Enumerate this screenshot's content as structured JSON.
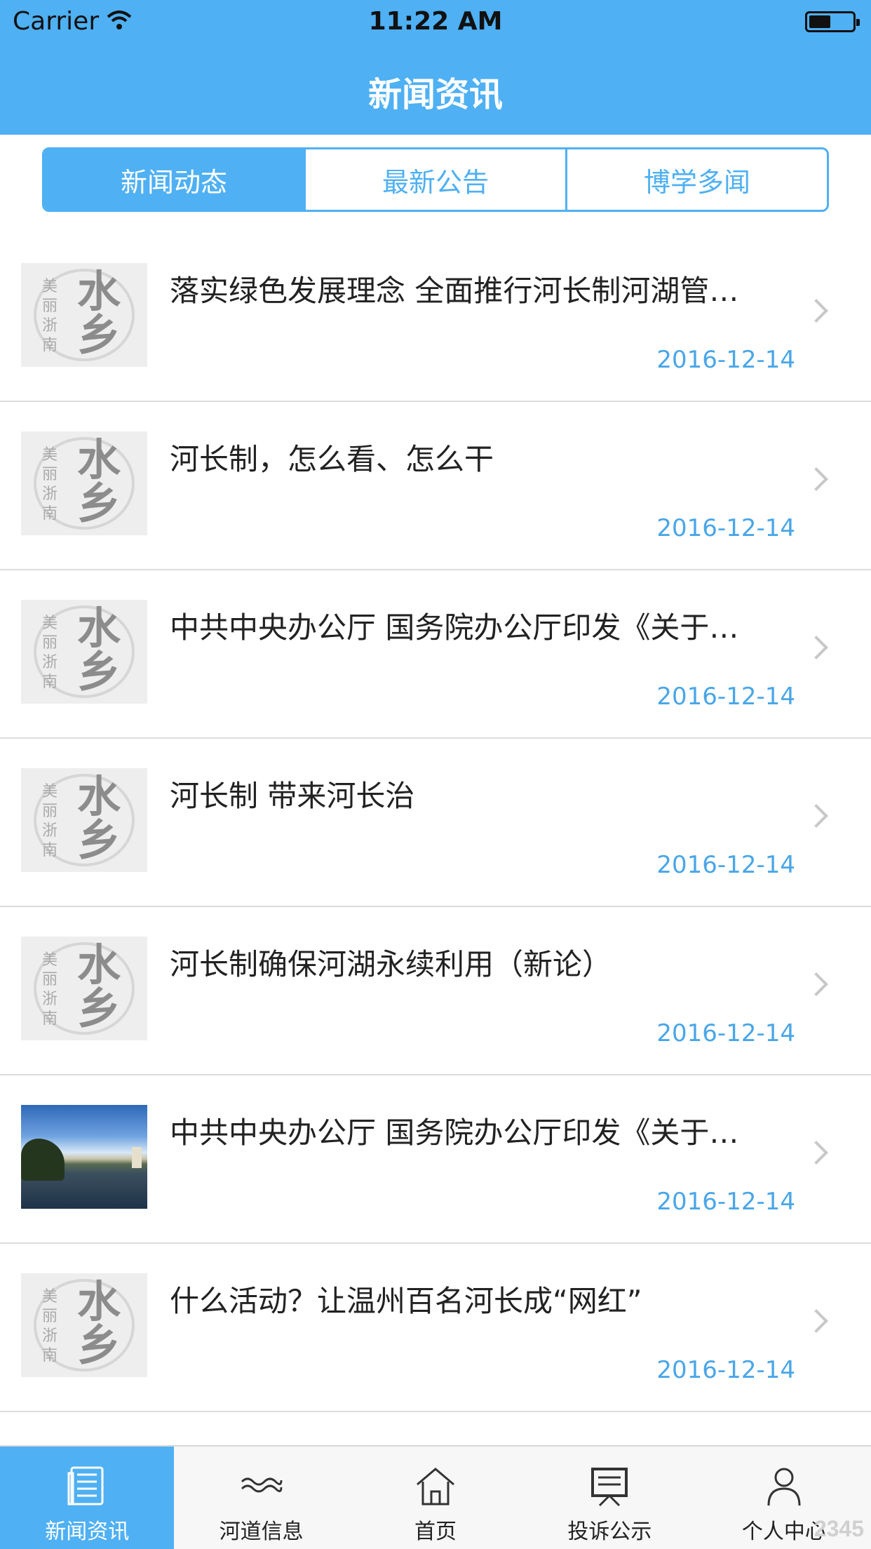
{
  "status_bar": {
    "carrier": "Carrier",
    "time": "11:22 AM"
  },
  "nav": {
    "title": "新闻资讯"
  },
  "segments": [
    {
      "label": "新闻动态",
      "active": true
    },
    {
      "label": "最新公告",
      "active": false
    },
    {
      "label": "博学多闻",
      "active": false
    }
  ],
  "news": [
    {
      "title": "落实绿色发展理念 全面推行河长制河湖管…",
      "date": "2016-12-14",
      "thumb": "logo"
    },
    {
      "title": "河长制，怎么看、怎么干",
      "date": "2016-12-14",
      "thumb": "logo"
    },
    {
      "title": "中共中央办公厅 国务院办公厅印发《关于…",
      "date": "2016-12-14",
      "thumb": "logo"
    },
    {
      "title": "河长制 带来河长治",
      "date": "2016-12-14",
      "thumb": "logo"
    },
    {
      "title": "河长制确保河湖永续利用（新论）",
      "date": "2016-12-14",
      "thumb": "logo"
    },
    {
      "title": "中共中央办公厅 国务院办公厅印发《关于…",
      "date": "2016-12-14",
      "thumb": "photo"
    },
    {
      "title": "什么活动？让温州百名河长成“网红”",
      "date": "2016-12-14",
      "thumb": "logo"
    }
  ],
  "thumb_logo": {
    "vertical_text": "美丽浙南",
    "big_text": "水乡"
  },
  "tabs": [
    {
      "label": "新闻资讯",
      "icon": "newspaper-icon",
      "active": true
    },
    {
      "label": "河道信息",
      "icon": "waves-icon",
      "active": false
    },
    {
      "label": "首页",
      "icon": "home-icon",
      "active": false
    },
    {
      "label": "投诉公示",
      "icon": "board-icon",
      "active": false
    },
    {
      "label": "个人中心",
      "icon": "user-icon",
      "active": false
    }
  ],
  "watermark": "2345",
  "colors": {
    "primary": "#4fb0f3",
    "date": "#4aa6e8"
  }
}
